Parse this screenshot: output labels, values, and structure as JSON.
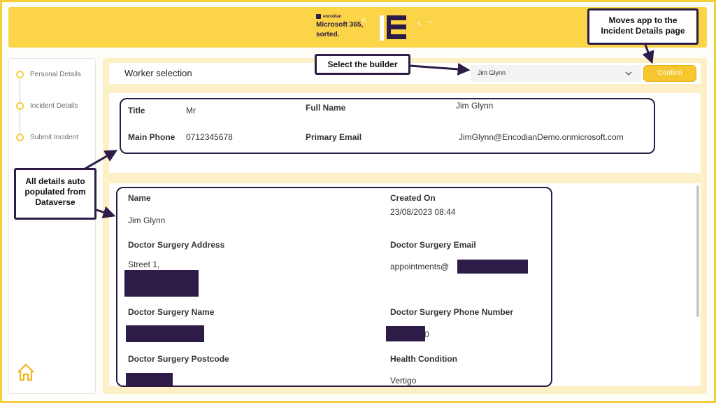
{
  "header": {
    "brand_small": "encodian",
    "brand_line1": "Microsoft 365,",
    "brand_line2": "sorted."
  },
  "sidebar": {
    "steps": [
      {
        "label": "Personal Details"
      },
      {
        "label": "Incident Details"
      },
      {
        "label": "Submit Incident"
      }
    ],
    "home_icon": "home-icon"
  },
  "worker": {
    "label": "Worker selection",
    "selected": "Jim Glynn",
    "confirm_label": "Confirm"
  },
  "details": {
    "title_label": "Title",
    "title_value": "Mr",
    "fullname_label": "Full Name",
    "fullname_value": "Jim Glynn",
    "phone_label": "Main Phone",
    "phone_value": "0712345678",
    "email_label": "Primary Email",
    "email_value": "JimGlynn@EncodianDemo.onmicrosoft.com"
  },
  "record": {
    "name_label": "Name",
    "name_value": "Jim Glynn",
    "created_label": "Created On",
    "created_value": "23/08/2023 08:44",
    "address_label": "Doctor Surgery Address",
    "address_value": "Street 1,",
    "surgery_email_label": "Doctor Surgery Email",
    "surgery_email_value": "appointments@",
    "surgery_name_label": "Doctor Surgery Name",
    "surgery_phone_label": "Doctor Surgery Phone Number",
    "surgery_phone_suffix": "0",
    "postcode_label": "Doctor Surgery Postcode",
    "condition_label": "Health Condition",
    "condition_value": "Vertigo"
  },
  "callouts": {
    "confirm_note_line1": "Moves app to the",
    "confirm_note_line2": "Incident Details page",
    "builder_note": "Select the builder",
    "auto_note_line1": "All details auto",
    "auto_note_line2": "populated from",
    "auto_note_line3": "Dataverse"
  },
  "colors": {
    "accent": "#fcd447",
    "dark": "#2c1c47",
    "panel_bg": "#fdf0c6"
  }
}
